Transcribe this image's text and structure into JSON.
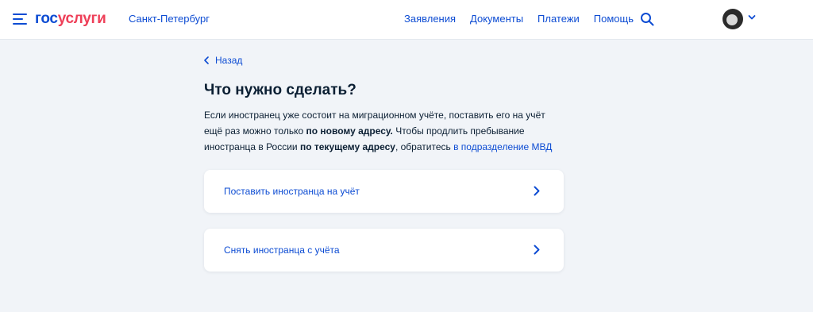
{
  "header": {
    "logo_part1": "гос",
    "logo_part2": "услуги",
    "city": "Санкт-Петербург",
    "nav": [
      "Заявления",
      "Документы",
      "Платежи",
      "Помощь"
    ]
  },
  "main": {
    "back_label": "Назад",
    "title": "Что нужно сделать?",
    "desc": {
      "t1": "Если иностранец уже состоит на миграционном учёте, поставить его на учёт ещё раз можно только ",
      "b1": "по новому адресу.",
      "t2": " Чтобы продлить пребывание иностранца в России ",
      "b2": "по текущему адресу",
      "t3": ", обратитесь ",
      "link": "в подразделение МВД"
    },
    "options": [
      {
        "label": "Поставить иностранца на учёт"
      },
      {
        "label": "Снять иностранца с учёта"
      }
    ]
  },
  "colors": {
    "accent": "#0d4cd3",
    "brand_red": "#ee3f58",
    "background": "#f1f4f8"
  },
  "icons": [
    "menu-icon",
    "search-icon",
    "avatar",
    "chevron-down-icon",
    "chevron-left-icon",
    "chevron-right-icon"
  ]
}
